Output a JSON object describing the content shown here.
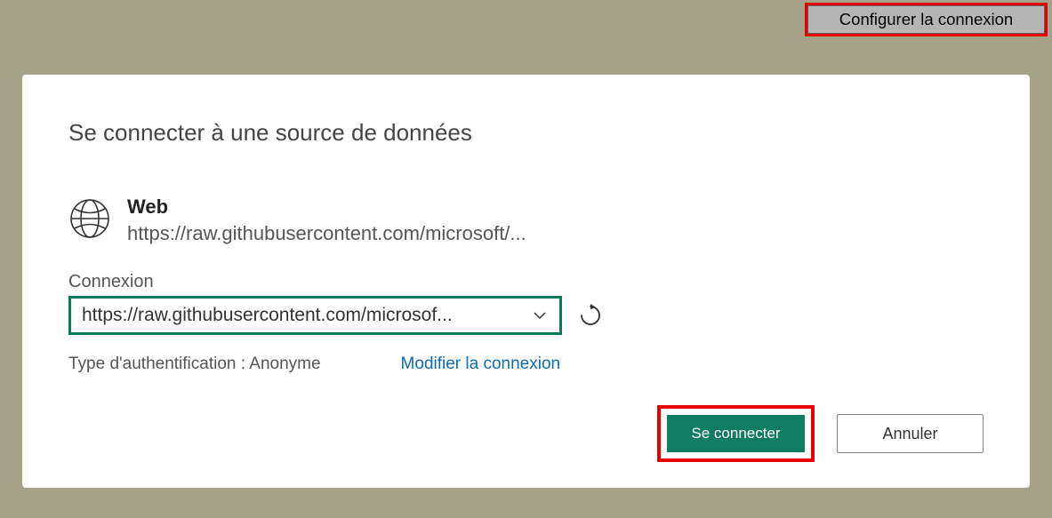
{
  "topbar": {
    "configure_label": "Configurer la connexion"
  },
  "dialog": {
    "title": "Se connecter à une source de données",
    "source": {
      "name": "Web",
      "url": "https://raw.githubusercontent.com/microsoft/..."
    },
    "connection": {
      "label": "Connexion",
      "selected": "https://raw.githubusercontent.com/microsof..."
    },
    "auth": {
      "type_label": "Type d'authentification : Anonyme",
      "edit_label": "Modifier la connexion"
    },
    "buttons": {
      "connect": "Se connecter",
      "cancel": "Annuler"
    }
  }
}
